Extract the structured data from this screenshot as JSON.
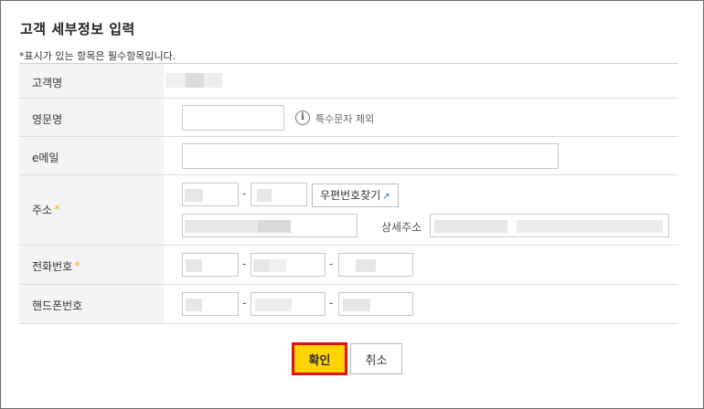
{
  "dialog": {
    "title": "고객 세부정보 입력",
    "required_note": "*표시가 있는 항목은 필수항목입니다."
  },
  "form": {
    "customer_name": {
      "label": "고객명"
    },
    "english_name": {
      "label": "영문명",
      "hint": "특수문자 제외",
      "hint_icon": "info-icon"
    },
    "email": {
      "label": "e메일"
    },
    "address": {
      "label": "주소",
      "required_mark": "*",
      "zip_button": "우편번호찾기",
      "zip_button_icon": "external-link-icon",
      "detail_label": "상세주소"
    },
    "phone": {
      "label": "전화번호",
      "required_mark": "*"
    },
    "mobile": {
      "label": "핸드폰번호"
    },
    "separator": "-"
  },
  "actions": {
    "confirm": "확인",
    "cancel": "취소"
  },
  "colors": {
    "confirm_bg": "#ffd200",
    "confirm_border": "#e01010",
    "required_star": "#f5b400",
    "label_cell_bg": "#f4f4f4"
  }
}
